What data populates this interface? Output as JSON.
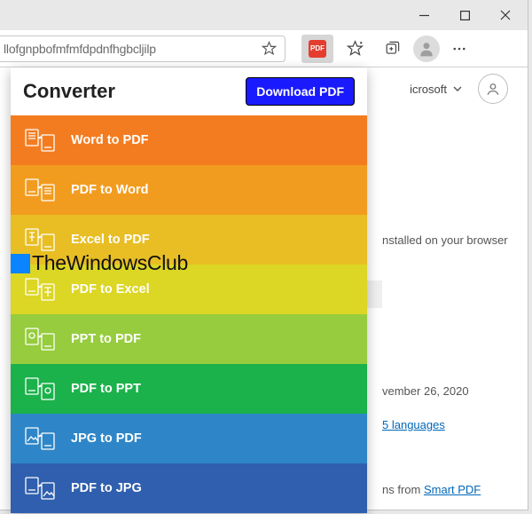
{
  "window": {
    "address_text": "llofgnpbofmfmfdpdnfhgbcljilp",
    "microsoft_label": "icrosoft"
  },
  "bg": {
    "install_fragment": "nstalled on your browser",
    "date_fragment": "vember 26, 2020",
    "languages_link": "5 languages",
    "from_link_prefix": "ns from ",
    "from_link": "Smart PDF"
  },
  "popup": {
    "title": "Converter",
    "download_label": "Download PDF",
    "options": [
      {
        "label": "Word to PDF"
      },
      {
        "label": "PDF to Word"
      },
      {
        "label": "Excel to PDF"
      },
      {
        "label": "PDF to Excel"
      },
      {
        "label": "PPT to PDF"
      },
      {
        "label": "PDF to PPT"
      },
      {
        "label": "JPG to PDF"
      },
      {
        "label": "PDF to JPG"
      }
    ]
  },
  "watermark": "TheWindowsClub"
}
